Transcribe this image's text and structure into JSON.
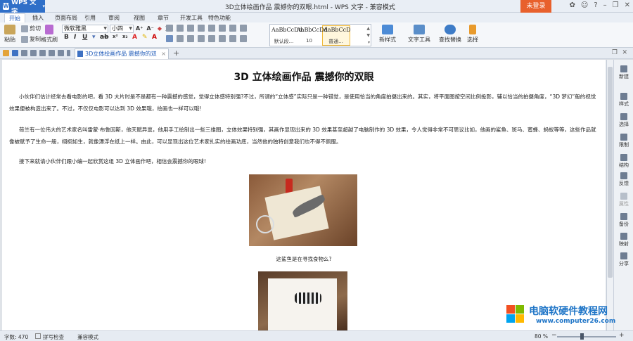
{
  "titlebar": {
    "app_name": "WPS 文字",
    "window_title": "3D立体绘画作品 震撼你的双眼.html - WPS 文字 - 兼容模式",
    "login": "未登录"
  },
  "ribbon_tabs": [
    "开始",
    "插入",
    "页面布局",
    "引用",
    "审阅",
    "视图",
    "章节",
    "开发工具",
    "特色功能"
  ],
  "ribbon": {
    "paste": "粘贴",
    "cut": "剪切",
    "copy": "复制",
    "format_painter": "格式刷",
    "font": "微软雅黑",
    "size": "小四",
    "styles": [
      {
        "preview": "AaBbCcDd",
        "name": "默认段..."
      },
      {
        "preview": "AaBbCcDd",
        "name": "10"
      },
      {
        "preview": "AaBbCcD",
        "name": "普通..."
      }
    ],
    "new_style": "新样式",
    "text_tools": "文字工具",
    "find_replace": "查找替换",
    "select": "选择"
  },
  "doc_tab": {
    "label": "3D立体绘画作品 震撼你的双眼.html"
  },
  "document": {
    "title": "3D 立体绘画作品  震撼你的双眼",
    "para1": "小伙伴们估计经常去看电影的吧，看 3D 大片时是不是都有一种震撼的感觉，觉得立体感特别强?不过，所谓的“立体感”实际只是一种错觉，是使用恰当的角度拍摄出来的。其实，将平面图按空间比例投影，辅以恰当的拍摄角度，“3D 梦幻”般的视觉效果便被构造出来了。不过，不仅仅电影可以达到 3D 效果哦，绘画也一样可以哦!",
    "para2": "荷兰有一位伟大的艺术家名叫雷蒙·布鲁因斯，他天赋异禀，他用手工绘制出一些三维图，立体效果特别强，其画作显现出来的 3D 效果甚至超越了电脑制作的 3D 效果，令人觉得非常不可思议比如，他画的鲨鱼、斑马、蜜蜂、蚂蚁等等，这些作品就像被赋予了生命一般，栩栩如生，就像漂浮在纸上一样。由此，可以显现出这位艺术家扎实的绘画功底，当然他的独特创意我们也不得不佩服。",
    "para3": "接下来就请小伙伴们跟小编一起欣赏这组 3D 立体画作吧，相信会震撼你的眼球!",
    "caption1": "这鲨鱼是在寻找食物么?"
  },
  "sidebar": [
    "新建",
    "样式",
    "选择",
    "限制",
    "结构",
    "反馈",
    "属性",
    "备份",
    "映射",
    "分享"
  ],
  "status": {
    "word_count": "字数: 470",
    "spell_check": "拼写检查",
    "compat_mode": "兼容模式",
    "zoom": "80 %"
  },
  "watermark": {
    "line1": "电脑软硬件教程网",
    "line2": "www.computer26.com"
  },
  "colors": {
    "accent": "#2f6fc8",
    "login": "#e8602c",
    "watermark": "#1f75c7"
  }
}
